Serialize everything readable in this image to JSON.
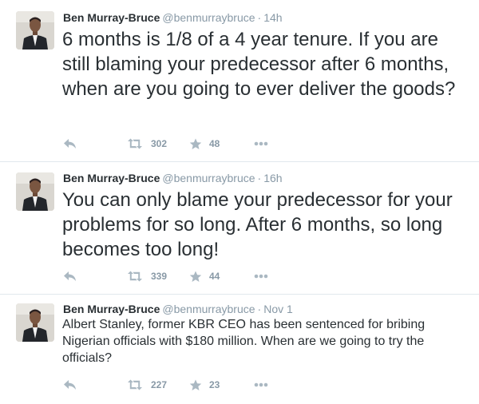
{
  "colors": {
    "text": "#292f33",
    "meta": "#8899a6",
    "icon": "#aab8c2",
    "divider": "#e1e8ed"
  },
  "tweets": [
    {
      "fullname": "Ben Murray-Bruce",
      "username": "@benmurraybruce",
      "separator": "·",
      "time": "14h",
      "text": "6 months is 1/8 of a 4 year tenure. If you are still blaming your predecessor after 6 months, when are you going to ever deliver the goods?",
      "retweets": "302",
      "favorites": "48",
      "icons": [
        "reply-icon",
        "retweet-icon",
        "favorite-icon",
        "more-icon"
      ]
    },
    {
      "fullname": "Ben Murray-Bruce",
      "username": "@benmurraybruce",
      "separator": "·",
      "time": "16h",
      "text": "You can only blame your predecessor for your problems for so long. After 6 months, so long becomes too long!",
      "retweets": "339",
      "favorites": "44",
      "icons": [
        "reply-icon",
        "retweet-icon",
        "favorite-icon",
        "more-icon"
      ]
    },
    {
      "fullname": "Ben Murray-Bruce",
      "username": "@benmurraybruce",
      "separator": "·",
      "time": "Nov 1",
      "text": "Albert Stanley, former KBR CEO has been sentenced for bribing Nigerian officials with $180 million. When are we going to try the officials?",
      "retweets": "227",
      "favorites": "23",
      "icons": [
        "reply-icon",
        "retweet-icon",
        "favorite-icon",
        "more-icon"
      ]
    }
  ]
}
